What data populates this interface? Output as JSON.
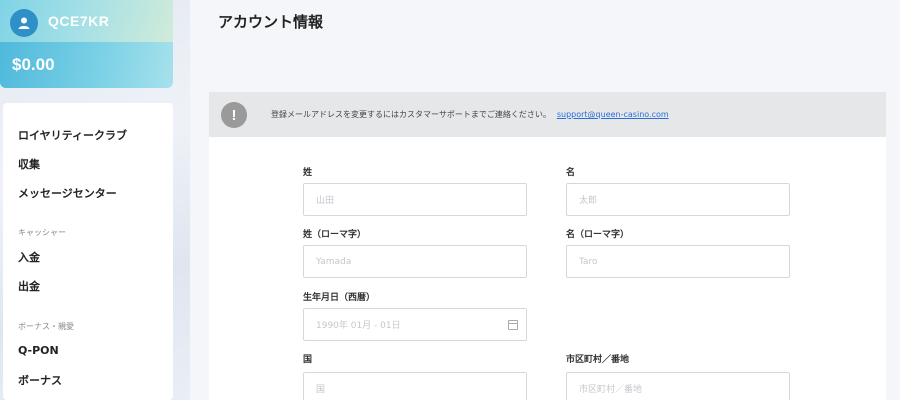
{
  "user": {
    "username": "QCE7KR",
    "balance": "$0.00"
  },
  "sidebar": {
    "items": [
      {
        "label": "ロイヤリティークラブ"
      },
      {
        "label": "収集"
      },
      {
        "label": "メッセージセンター"
      }
    ],
    "cashier_section": "キャッシャー",
    "cashier_items": [
      {
        "label": "入金"
      },
      {
        "label": "出金"
      }
    ],
    "bonus_section": "ボーナス・親愛",
    "bonus_items": [
      {
        "label": "Q-PON"
      },
      {
        "label": "ボーナス"
      }
    ]
  },
  "page": {
    "title": "アカウント情報"
  },
  "notice": {
    "icon": "!",
    "text": "登録メールアドレスを変更するにはカスタマーサポートまでご連絡ください。",
    "link": "support@queen-casino.com"
  },
  "form": {
    "last_name": {
      "label": "姓",
      "placeholder": "山田"
    },
    "first_name": {
      "label": "名",
      "placeholder": "太郎"
    },
    "last_name_roman": {
      "label": "姓（ローマ字）",
      "placeholder": "Yamada"
    },
    "first_name_roman": {
      "label": "名（ローマ字）",
      "placeholder": "Taro"
    },
    "birthdate": {
      "label": "生年月日（西暦）",
      "placeholder": "1990年 01月 - 01日"
    },
    "country": {
      "label": "国",
      "placeholder": "国"
    },
    "city": {
      "label": "市区町村／番地",
      "placeholder": "市区町村／番地"
    }
  }
}
